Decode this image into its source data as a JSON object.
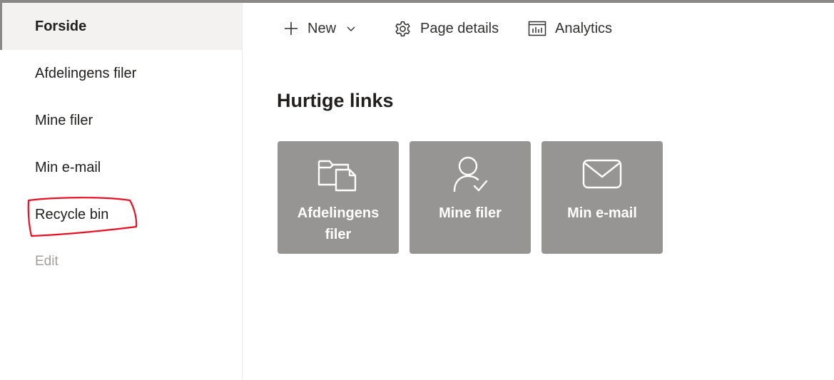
{
  "sidebar": {
    "items": [
      {
        "label": "Forside"
      },
      {
        "label": "Afdelingens filer"
      },
      {
        "label": "Mine filer"
      },
      {
        "label": "Min e-mail"
      },
      {
        "label": "Recycle bin"
      },
      {
        "label": "Edit"
      }
    ]
  },
  "commandbar": {
    "new_label": "New",
    "page_details_label": "Page details",
    "analytics_label": "Analytics"
  },
  "main": {
    "title": "Hurtige links",
    "quick_links": [
      {
        "label": "Afdelingens filer",
        "icon": "folder-document-icon"
      },
      {
        "label": "Mine filer",
        "icon": "person-check-icon"
      },
      {
        "label": "Min e-mail",
        "icon": "mail-icon"
      }
    ]
  },
  "colors": {
    "tile_bg": "#979593",
    "active_nav_bg": "#f3f2f1",
    "annotation_red": "#e81123",
    "disabled_text": "#a19f9d"
  }
}
